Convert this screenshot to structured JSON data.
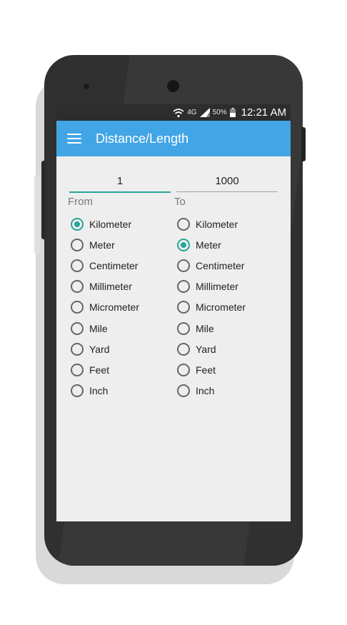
{
  "status_bar": {
    "network_label": "4G",
    "battery_text": "50%",
    "time": "12:21 AM"
  },
  "app_bar": {
    "title": "Distance/Length",
    "menu_icon": "hamburger-menu-icon"
  },
  "from_value": "1",
  "to_value": "1000",
  "from_label": "From",
  "to_label": "To",
  "units": [
    "Kilometer",
    "Meter",
    "Centimeter",
    "Millimeter",
    "Micrometer",
    "Mile",
    "Yard",
    "Feet",
    "Inch"
  ],
  "from_selected": "Kilometer",
  "to_selected": "Meter",
  "colors": {
    "app_bar": "#42a5e5",
    "accent": "#26a69a",
    "status_bar": "#2d2d2d",
    "background": "#eeeeee"
  }
}
